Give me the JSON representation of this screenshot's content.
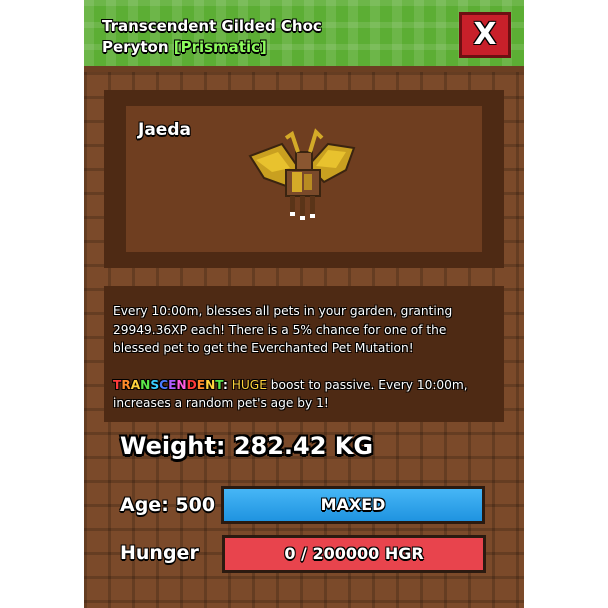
{
  "header": {
    "title_line1": "Transcendent Gilded Choc",
    "title_line2": "Peryton",
    "mutation": "[Prismatic]",
    "close_label": "X"
  },
  "viewer": {
    "owner_name": "Jaeda"
  },
  "description": {
    "passive": "Every 10:00m, blesses all pets in your garden, granting 29949.36XP each! There is a 5% chance for one of the blessed pet to get the Everchanted Pet Mutation!",
    "transcendent_label": "TRANSCENDENT:",
    "transcendent_huge": "HUGE",
    "transcendent_text": "boost to passive. Every 10:00m, increases a random pet's age by 1!"
  },
  "stats": {
    "weight": "Weight: 282.42 KG",
    "age_label": "Age: 500",
    "age_bar": "MAXED",
    "age_fill": 1.0,
    "hunger_label": "Hunger",
    "hunger_bar": "0 / 200000 HGR",
    "hunger_fill": 0.0
  },
  "colors": {
    "header_green": "#5cae34",
    "panel_brown": "#7b4a2a",
    "close_red": "#c8202a",
    "age_bar_blue": "#1f93e0",
    "hunger_bar_red": "#e8444d",
    "mutation_green": "#8dfc5c",
    "huge_yellow": "#ffd23c"
  }
}
